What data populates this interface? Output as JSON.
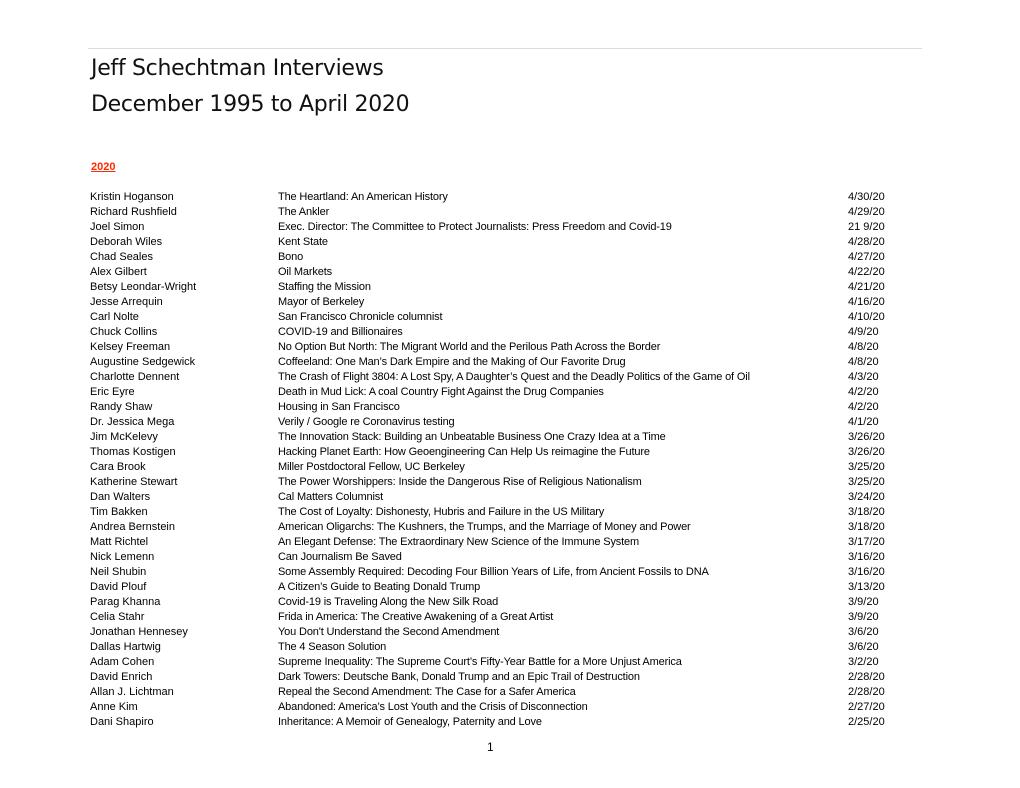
{
  "header": {
    "title": "Jeff Schechtman Interviews",
    "subtitle": "December 1995 to April 2020"
  },
  "section": {
    "year": "2020",
    "year_color": "#ff2a00"
  },
  "interviews": [
    {
      "name": "Kristin Hoganson",
      "title": "The Heartland: An American History",
      "date": "4/30/20"
    },
    {
      "name": "Richard Rushfield",
      "title": "The Ankler",
      "date": "4/29/20"
    },
    {
      "name": "Joel Simon",
      "title": "Exec. Director: The Committee to Protect Journalists: Press Freedom and Covid-19",
      "date": "21 9/20"
    },
    {
      "name": "Deborah Wiles",
      "title": "Kent State",
      "date": "4/28/20"
    },
    {
      "name": "Chad Seales",
      "title": "Bono",
      "date": "4/27/20"
    },
    {
      "name": "Alex Gilbert",
      "title": "Oil Markets",
      "date": "4/22/20"
    },
    {
      "name": "Betsy Leondar-Wright",
      "title": "Staffing the Mission",
      "date": "4/21/20"
    },
    {
      "name": "Jesse Arrequin",
      "title": "Mayor of Berkeley",
      "date": "4/16/20"
    },
    {
      "name": "Carl Nolte",
      "title": "San Francisco Chronicle columnist",
      "date": "4/10/20"
    },
    {
      "name": "Chuck Collins",
      "title": "COVID-19 and Billionaires",
      "date": "4/9/20"
    },
    {
      "name": "Kelsey Freeman",
      "title": "No Option But North: The Migrant World and the Perilous Path Across the Border",
      "date": "4/8/20"
    },
    {
      "name": "Augustine Sedgewick",
      "title": "Coffeeland: One Man’s Dark Empire and the Making of Our Favorite Drug",
      "date": "4/8/20"
    },
    {
      "name": "Charlotte Dennent",
      "title": "The Crash of Flight 3804: A Lost Spy, A Daughter’s Quest and the Deadly Politics of the Game of Oil",
      "date": "4/3/20"
    },
    {
      "name": "Eric Eyre",
      "title": "Death in Mud Lick: A coal Country Fight Against the Drug Companies",
      "date": "4/2/20"
    },
    {
      "name": "Randy Shaw",
      "title": "Housing in San Francisco",
      "date": "4/2/20"
    },
    {
      "name": "Dr. Jessica Mega",
      "title": "Verily / Google re Coronavirus testing",
      "date": "4/1/20"
    },
    {
      "name": "Jim McKelevy",
      "title": "The Innovation Stack: Building an Unbeatable Business One Crazy Idea at a Time",
      "date": "3/26/20"
    },
    {
      "name": "Thomas Kostigen",
      "title": "Hacking Planet Earth: How Geoengineering Can Help Us reimagine the Future",
      "date": "3/26/20"
    },
    {
      "name": "Cara Brook",
      "title": "Miller Postdoctoral Fellow, UC Berkeley",
      "date": "3/25/20"
    },
    {
      "name": "Katherine Stewart",
      "title": "The Power Worshippers: Inside the Dangerous Rise of Religious Nationalism",
      "date": "3/25/20"
    },
    {
      "name": "Dan Walters",
      "title": "Cal Matters Columnist",
      "date": "3/24/20"
    },
    {
      "name": "Tim Bakken",
      "title": "The Cost of Loyalty: Dishonesty, Hubris and Failure in the US Military",
      "date": "3/18/20"
    },
    {
      "name": "Andrea Bernstein",
      "title": "American Oligarchs: The Kushners, the Trumps, and the Marriage of Money and Power",
      "date": "3/18/20"
    },
    {
      "name": "Matt Richtel",
      "title": "An Elegant Defense: The Extraordinary New Science of the Immune System",
      "date": "3/17/20"
    },
    {
      "name": "Nick Lemenn",
      "title": "Can Journalism Be Saved",
      "date": "3/16/20"
    },
    {
      "name": "Neil Shubin",
      "title": "Some Assembly Required: Decoding Four Billion Years of Life, from Ancient Fossils to DNA",
      "date": "3/16/20"
    },
    {
      "name": "David Plouf",
      "title": "A Citizen’s Guide to Beating Donald Trump",
      "date": "3/13/20"
    },
    {
      "name": "Parag Khanna",
      "title": "Covid-19 is Traveling Along the New Silk Road",
      "date": "3/9/20"
    },
    {
      "name": "Celia Stahr",
      "title": "Frida in America: The Creative Awakening of a Great Artist",
      "date": "3/9/20"
    },
    {
      "name": "Jonathan Hennesey",
      "title": "You Don't Understand the Second Amendment",
      "date": "3/6/20"
    },
    {
      "name": "Dallas Hartwig",
      "title": "The 4 Season Solution",
      "date": "3/6/20"
    },
    {
      "name": "Adam Cohen",
      "title": "Supreme Inequality: The Supreme Court’s Fifty-Year Battle for a More Unjust America",
      "date": "3/2/20"
    },
    {
      "name": "David Enrich",
      "title": "Dark Towers: Deutsche Bank, Donald Trump and an Epic Trail of Destruction",
      "date": "2/28/20"
    },
    {
      "name": "Allan J. Lichtman",
      "title": "Repeal the Second Amendment: The Case for a Safer America",
      "date": "2/28/20"
    },
    {
      "name": "Anne Kim",
      "title": "Abandoned: America’s Lost Youth and the Crisis of Disconnection",
      "date": "2/27/20"
    },
    {
      "name": "Dani Shapiro",
      "title": "Inheritance: A Memoir of Genealogy, Paternity and Love",
      "date": "2/25/20"
    }
  ],
  "footer": {
    "page_number": "1"
  }
}
